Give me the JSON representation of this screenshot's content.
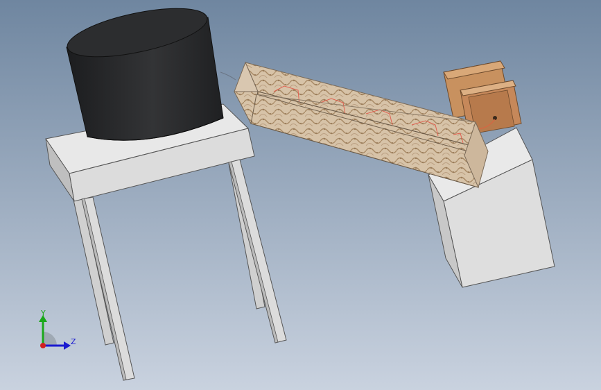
{
  "viewport": {
    "background_top": "#6f86a0",
    "background_bottom": "#c9d2df"
  },
  "triad": {
    "y_label": "Y",
    "z_label": "Z",
    "y_color": "#1aa81a",
    "z_color": "#1a1ad0",
    "origin_color": "#d02020"
  },
  "colors": {
    "tank": "#2a2b2d",
    "table": "#e6e6e6",
    "table_side": "#bdbdbd",
    "leg": "#d8d8d8",
    "trough_texture": "#cbb59a",
    "trough_edge": "#7a6a58",
    "wire": "#e06040",
    "box": "#d8d8d8",
    "motor": "#c58a5a"
  }
}
